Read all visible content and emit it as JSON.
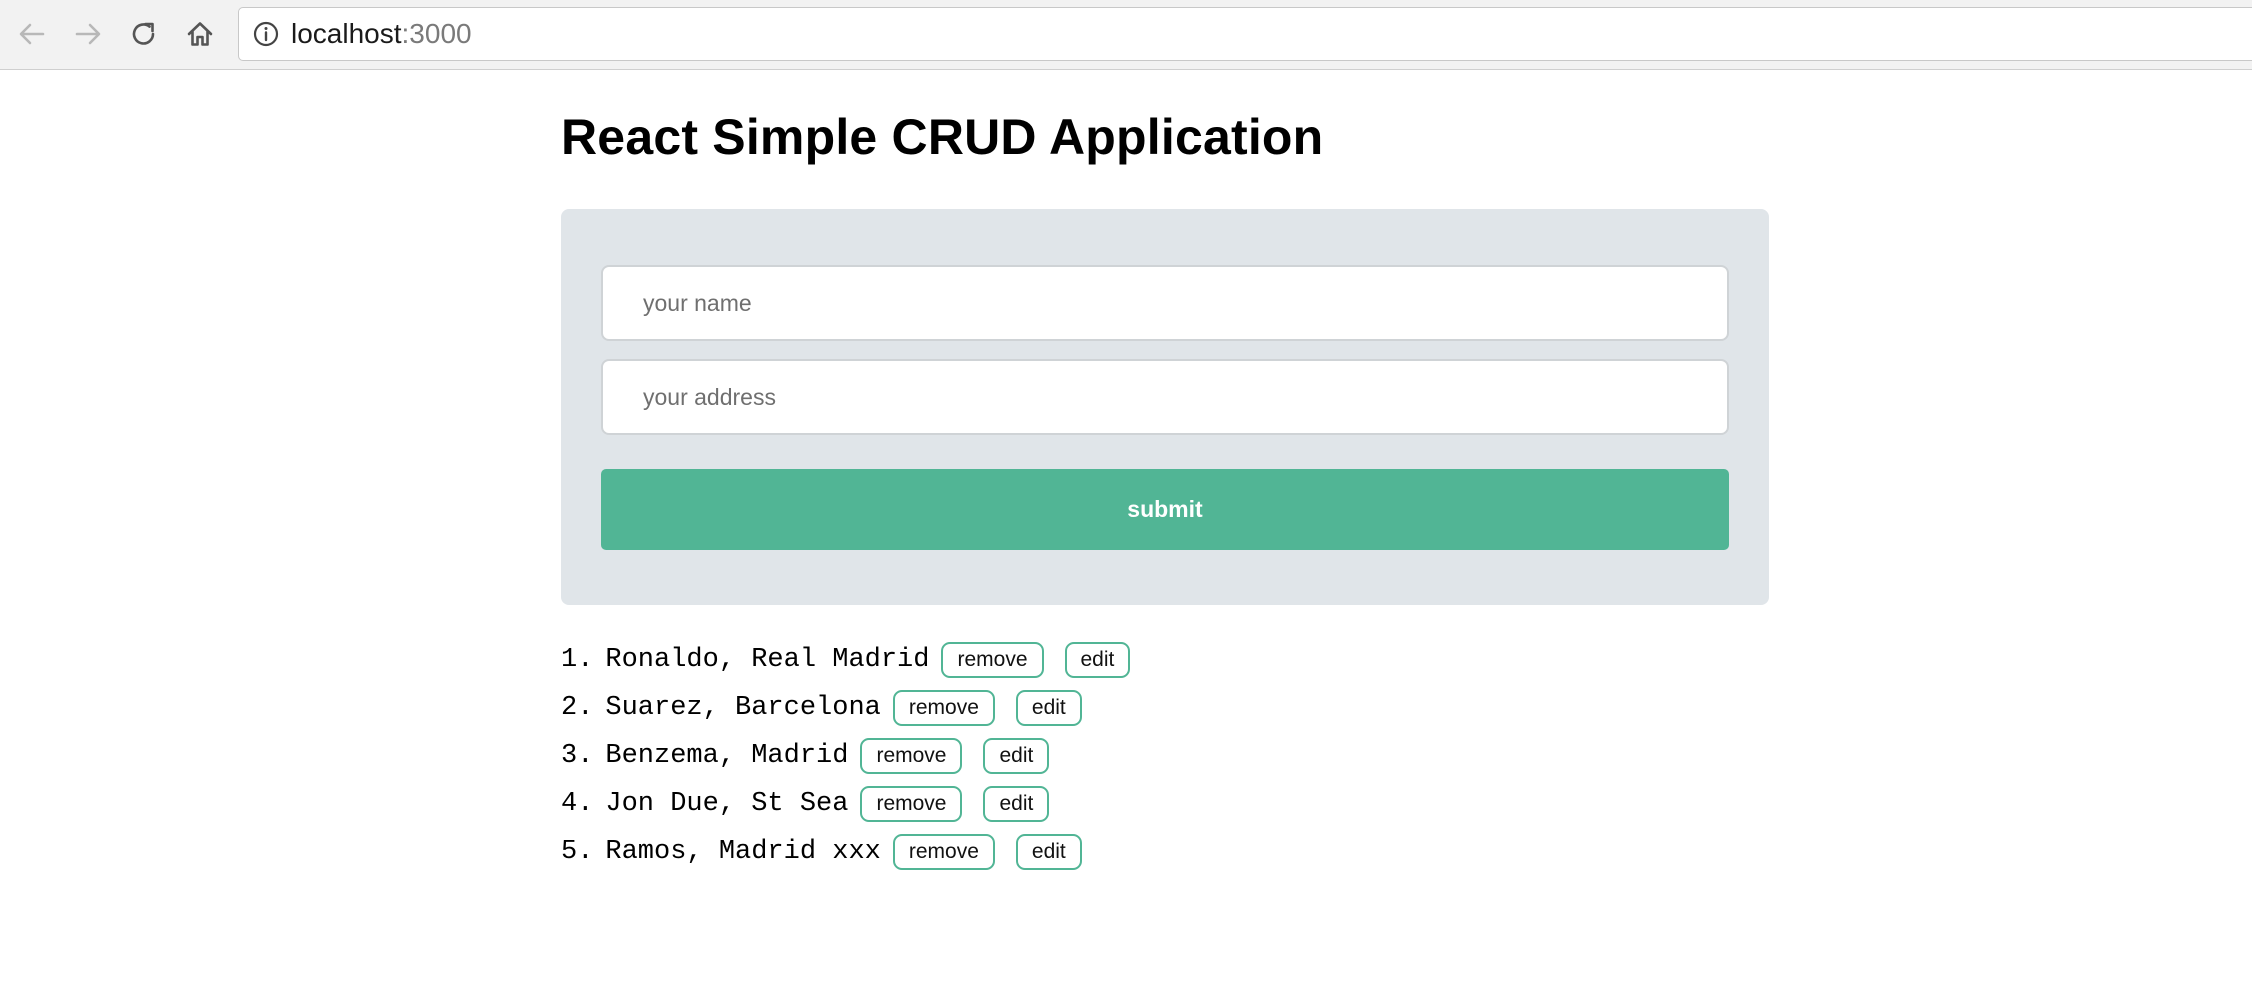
{
  "browser": {
    "url_host": "localhost",
    "url_port": ":3000",
    "icons": {
      "back": "arrow-left-icon",
      "forward": "arrow-right-icon",
      "reload": "reload-icon",
      "home": "home-icon",
      "info": "info-icon"
    }
  },
  "page": {
    "title": "React Simple CRUD Application"
  },
  "form": {
    "name_placeholder": "your name",
    "name_value": "",
    "address_placeholder": "your address",
    "address_value": "",
    "submit_label": "submit"
  },
  "players": [
    {
      "number": "1.",
      "text": "Ronaldo, Real Madrid",
      "remove_label": "remove",
      "edit_label": "edit"
    },
    {
      "number": "2.",
      "text": "Suarez, Barcelona",
      "remove_label": "remove",
      "edit_label": "edit"
    },
    {
      "number": "3.",
      "text": "Benzema, Madrid",
      "remove_label": "remove",
      "edit_label": "edit"
    },
    {
      "number": "4.",
      "text": "Jon Due, St Sea",
      "remove_label": "remove",
      "edit_label": "edit"
    },
    {
      "number": "5.",
      "text": "Ramos, Madrid xxx",
      "remove_label": "remove",
      "edit_label": "edit"
    }
  ],
  "colors": {
    "accent": "#51b595",
    "panel_bg": "#e0e5e9",
    "toolbar_bg": "#f2f2f2"
  }
}
